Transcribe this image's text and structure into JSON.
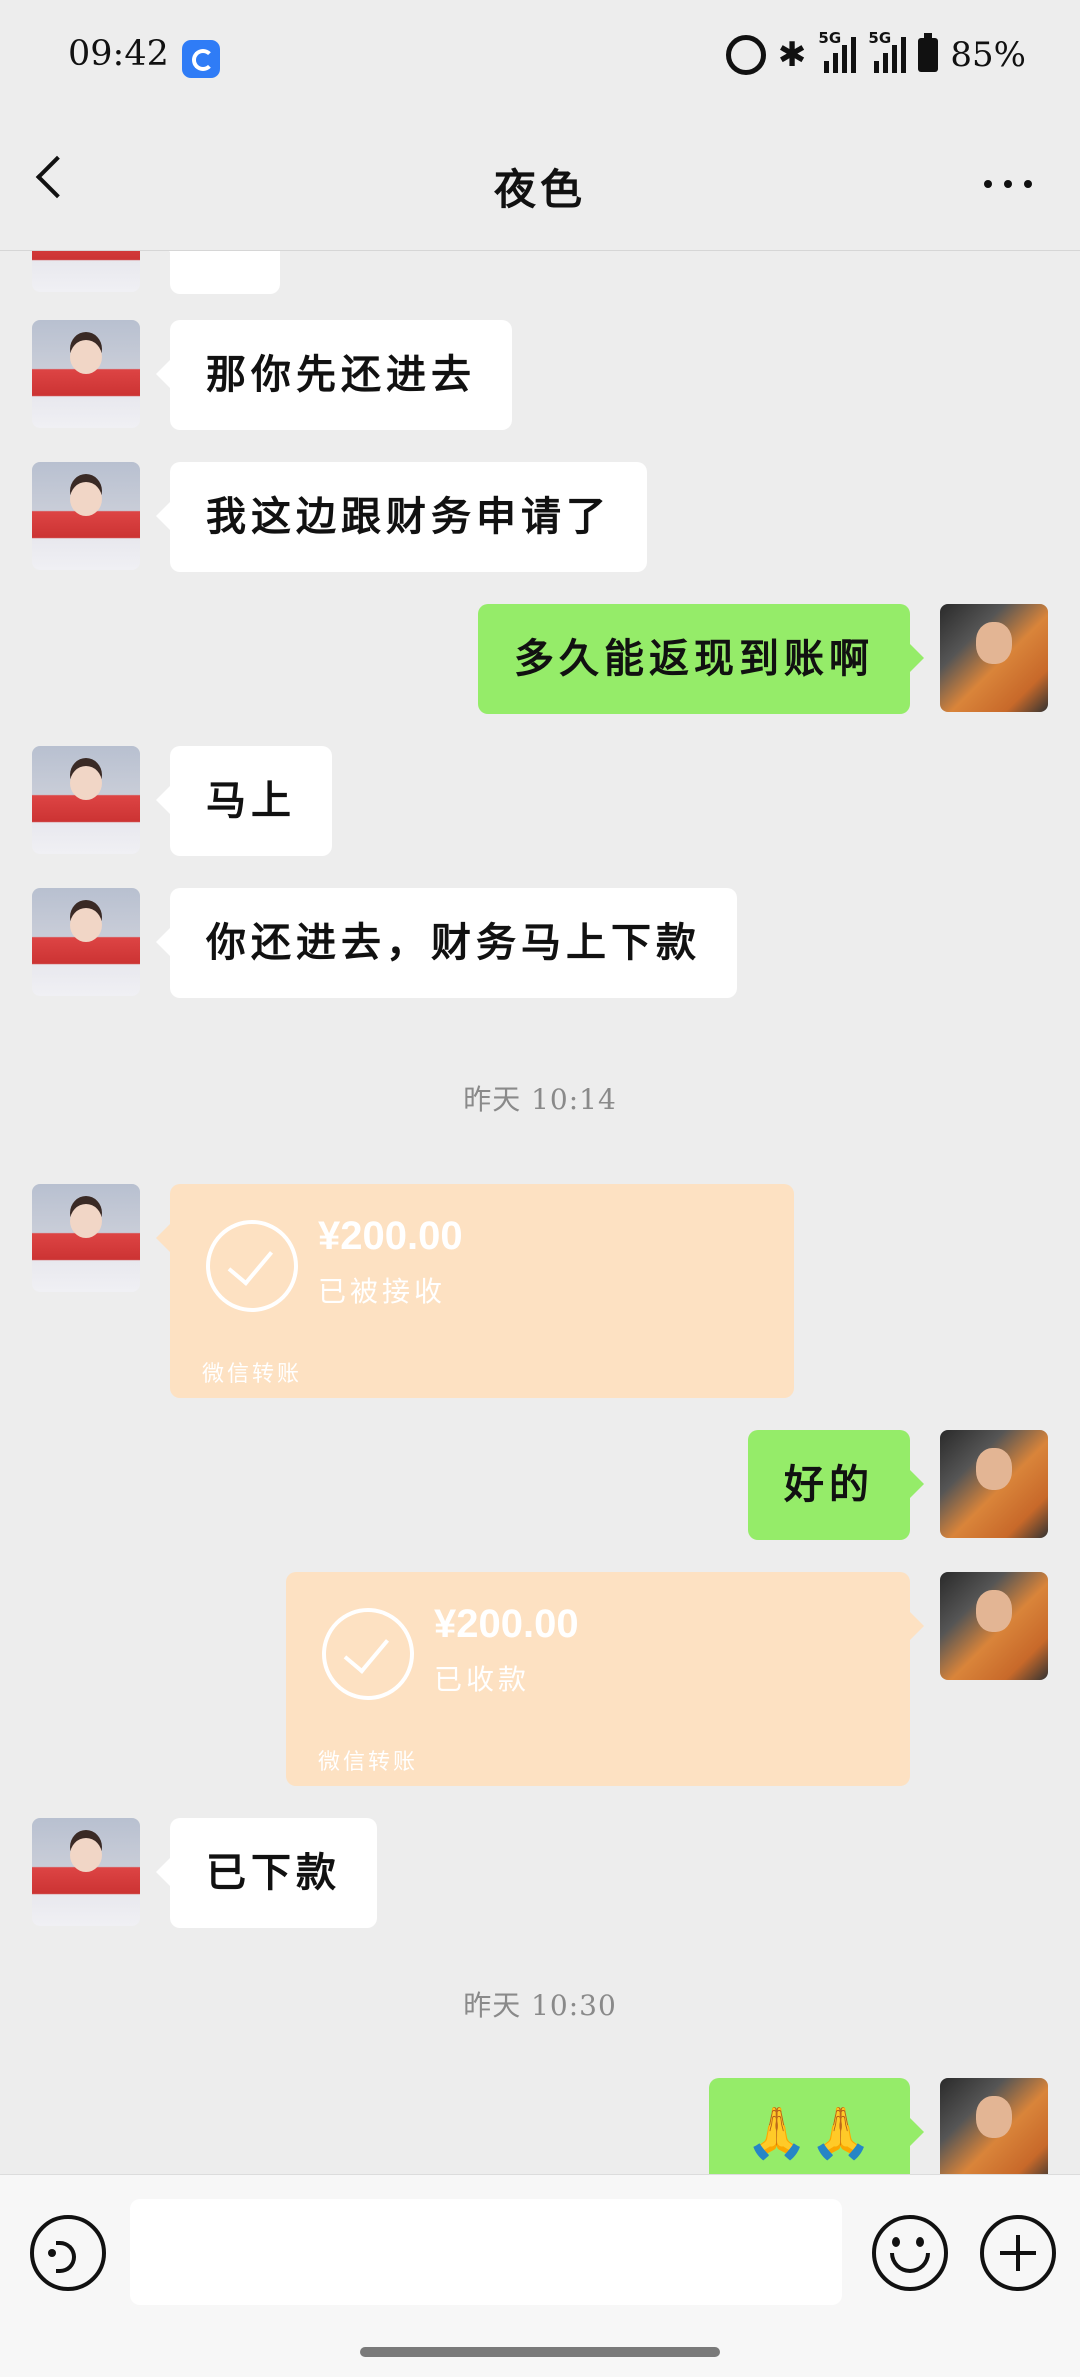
{
  "status_bar": {
    "time": "09:42",
    "battery": "85%",
    "network1": "5G",
    "network2": "5G"
  },
  "header": {
    "title": "夜色",
    "back_icon": "chevron-left-icon",
    "more_icon": "ellipsis-icon"
  },
  "messages": [
    {
      "side": "left",
      "text": "那你先还进去"
    },
    {
      "side": "left",
      "text": "我这边跟财务申请了"
    },
    {
      "side": "right",
      "text": "多久能返现到账啊"
    },
    {
      "side": "left",
      "text": "马上"
    },
    {
      "side": "left",
      "text": "你还进去，财务马上下款"
    },
    {
      "type": "timestamp",
      "text": "昨天 10:14"
    },
    {
      "side": "left",
      "type": "transfer",
      "amount": "¥200.00",
      "status": "已被接收",
      "label": "微信转账"
    },
    {
      "side": "right",
      "text": "好的"
    },
    {
      "side": "right",
      "type": "transfer",
      "amount": "¥200.00",
      "status": "已收款",
      "label": "微信转账"
    },
    {
      "side": "left",
      "text": "已下款"
    },
    {
      "type": "timestamp",
      "text": "昨天 10:30"
    },
    {
      "side": "right",
      "text": "🙏🙏"
    }
  ],
  "input_bar": {
    "placeholder": "",
    "icons": [
      "voice-icon",
      "emoji-icon",
      "plus-icon"
    ]
  },
  "colors": {
    "background": "#ededed",
    "sent_bubble": "#95ec69",
    "received_bubble": "#ffffff",
    "transfer_card": "#fde1c2"
  }
}
